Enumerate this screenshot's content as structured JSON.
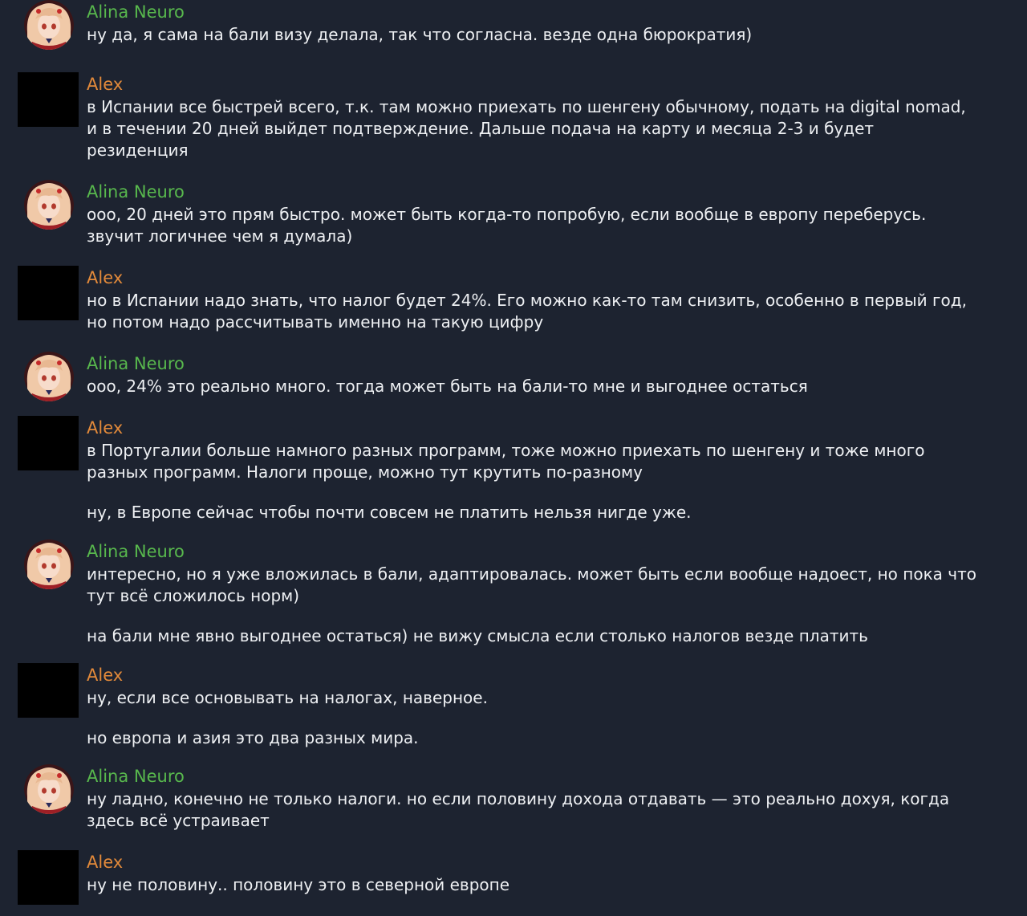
{
  "messages": [
    {
      "author": "Alina Neuro",
      "role": "alina",
      "lines": [
        "ну да, я сама на бали визу делала, так что согласна. везде одна бюрократия)"
      ]
    },
    {
      "author": "Alex",
      "role": "alex",
      "lines": [
        "в Испании все быстрей всего, т.к. там можно приехать по шенгену обычному, подать на digital nomad,",
        "и в течении 20 дней выйдет подтверждение. Дальше подача на карту и месяца 2-3 и будет",
        "резиденция"
      ]
    },
    {
      "author": "Alina Neuro",
      "role": "alina",
      "lines": [
        "ооо, 20 дней это прям быстро. может быть когда-то попробую, если вообще в европу переберусь.",
        "звучит логичнее чем я думала)"
      ]
    },
    {
      "author": "Alex",
      "role": "alex",
      "lines": [
        "но в Испании надо знать, что налог будет 24%. Его можно как-то там снизить, особенно в первый год,",
        "но потом надо рассчитывать именно на такую цифру"
      ]
    },
    {
      "author": "Alina Neuro",
      "role": "alina",
      "lines": [
        "ооо, 24% это реально много. тогда может быть на бали-то мне и выгоднее остаться"
      ]
    },
    {
      "author": "Alex",
      "role": "alex",
      "lines": [
        "в Португалии больше намного разных программ, тоже можно приехать по шенгену и тоже много",
        "разных программ.  Налоги проще, можно тут крутить по-разному"
      ],
      "extra": [
        "ну, в Европе сейчас чтобы почти совсем не платить нельзя нигде уже."
      ]
    },
    {
      "author": "Alina Neuro",
      "role": "alina",
      "lines": [
        "интересно, но я уже вложилась в бали, адаптировалась. может быть если вообще надоест, но пока что",
        "тут всё сложилось норм)"
      ],
      "extra": [
        "на бали мне явно выгоднее остаться) не вижу смысла если столько налогов везде платить"
      ]
    },
    {
      "author": "Alex",
      "role": "alex",
      "lines": [
        "ну, если все основывать на налогах, наверное."
      ],
      "extra": [
        "но европа и азия это два разных мира."
      ]
    },
    {
      "author": "Alina Neuro",
      "role": "alina",
      "lines": [
        "ну ладно, конечно не только налоги. но если половину дохода отдавать — это реально дохуя, когда",
        "здесь всё устраивает"
      ]
    },
    {
      "author": "Alex",
      "role": "alex",
      "lines": [
        "ну не половину.. половину это в северной европе"
      ]
    }
  ]
}
